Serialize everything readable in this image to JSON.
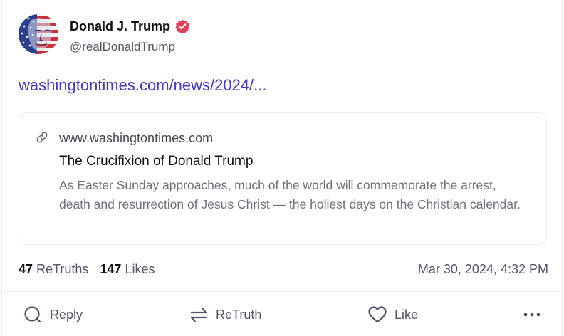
{
  "author": {
    "name": "Donald J. Trump",
    "handle": "@realDonaldTrump",
    "verified": true
  },
  "post": {
    "link_text": "washingtontimes.com/news/2024/..."
  },
  "link_card": {
    "domain": "www.washingtontimes.com",
    "title": "The Crucifixion of Donald Trump",
    "description": "As Easter Sunday approaches, much of the world will commemorate the arrest, death and resurrection of Jesus Christ — the holiest days on the Christian calendar."
  },
  "stats": {
    "retruths_count": "47",
    "retruths_label": "ReTruths",
    "likes_count": "147",
    "likes_label": "Likes",
    "timestamp": "Mar 30, 2024, 4:32 PM"
  },
  "actions": {
    "reply_label": "Reply",
    "retruth_label": "ReTruth",
    "like_label": "Like"
  },
  "colors": {
    "link": "#4338ca",
    "verified_badge": "#e2405d",
    "muted_text": "#54546a"
  }
}
